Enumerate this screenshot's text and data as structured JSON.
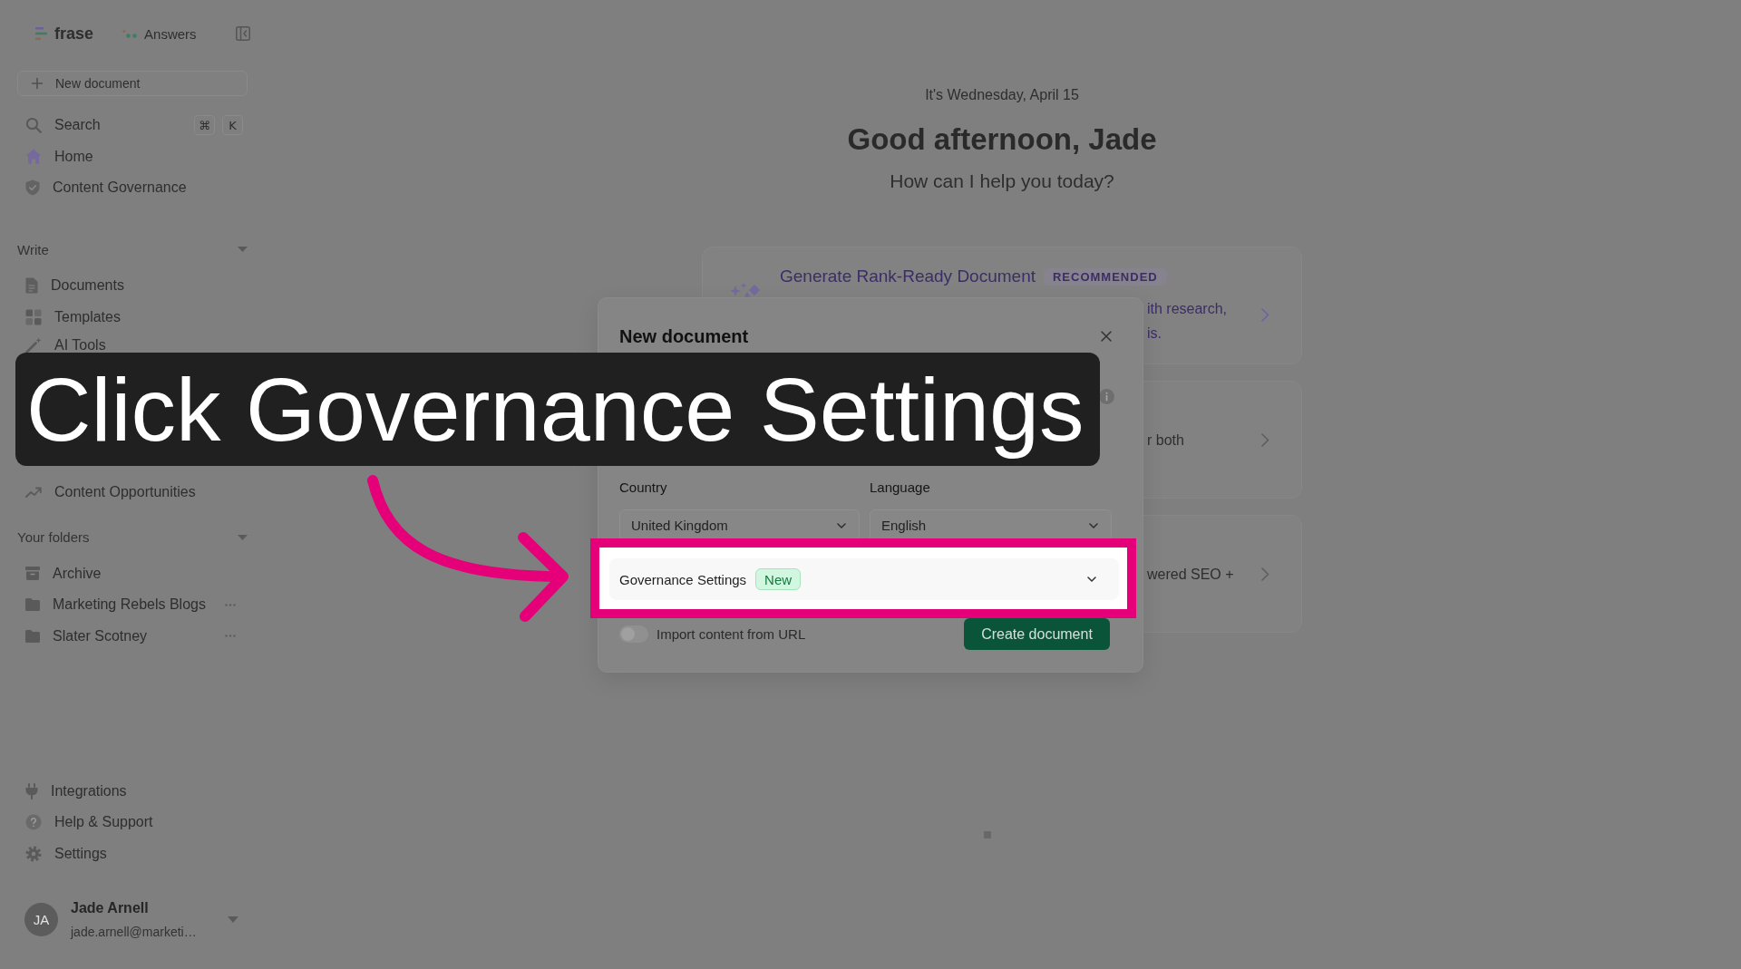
{
  "sidebar": {
    "logo": "frase",
    "answers_link": "Answers",
    "new_document_button": "New document",
    "search": {
      "label": "Search",
      "shortcut": [
        "⌘",
        "K"
      ]
    },
    "nav_items": [
      "Home",
      "Content Governance"
    ],
    "write_section": {
      "title": "Write",
      "expanded": true,
      "items": [
        "Documents",
        "Templates",
        "AI Tools"
      ]
    },
    "section_2": {
      "items": [
        "Content Opportunities"
      ]
    },
    "folders_section": {
      "title": "Your folders",
      "expanded": true,
      "items": [
        {
          "kind": "archive",
          "label": "Archive"
        },
        {
          "kind": "folder",
          "label": "Marketing Rebels Blogs"
        },
        {
          "kind": "folder",
          "label": "Slater Scotney"
        }
      ]
    },
    "bottom_items": [
      "Integrations",
      "Help & Support",
      "Settings"
    ],
    "user": {
      "initials": "JA",
      "name": "Jade Arnell",
      "email": "jade.arnell@marketi…"
    }
  },
  "greeting": {
    "date": "It's Wednesday, April 15",
    "title": "Good afternoon, Jade",
    "subtitle": "How can I help you today?"
  },
  "cards": [
    {
      "kind": "recommended",
      "title": "Generate Rank-Ready Document",
      "badge": "RECOMMENDED",
      "text_lines": [
        "ith research,",
        "is."
      ]
    },
    {
      "kind": "standard",
      "text_lines": [
        "r both"
      ]
    },
    {
      "kind": "standard",
      "text_lines": [
        "wered SEO +"
      ]
    }
  ],
  "dialog": {
    "title": "New document",
    "fields": [
      {
        "label": "Country",
        "value": "United Kingdom"
      },
      {
        "label": "Language",
        "value": "English"
      }
    ],
    "governance": {
      "label": "Governance Settings",
      "badge": "New",
      "expanded": false,
      "highlighted": true
    },
    "import_toggle": {
      "label": "Import content from URL",
      "on": false
    },
    "create_button": "Create document"
  },
  "tutorial": {
    "caption": "Click Governance Settings"
  }
}
